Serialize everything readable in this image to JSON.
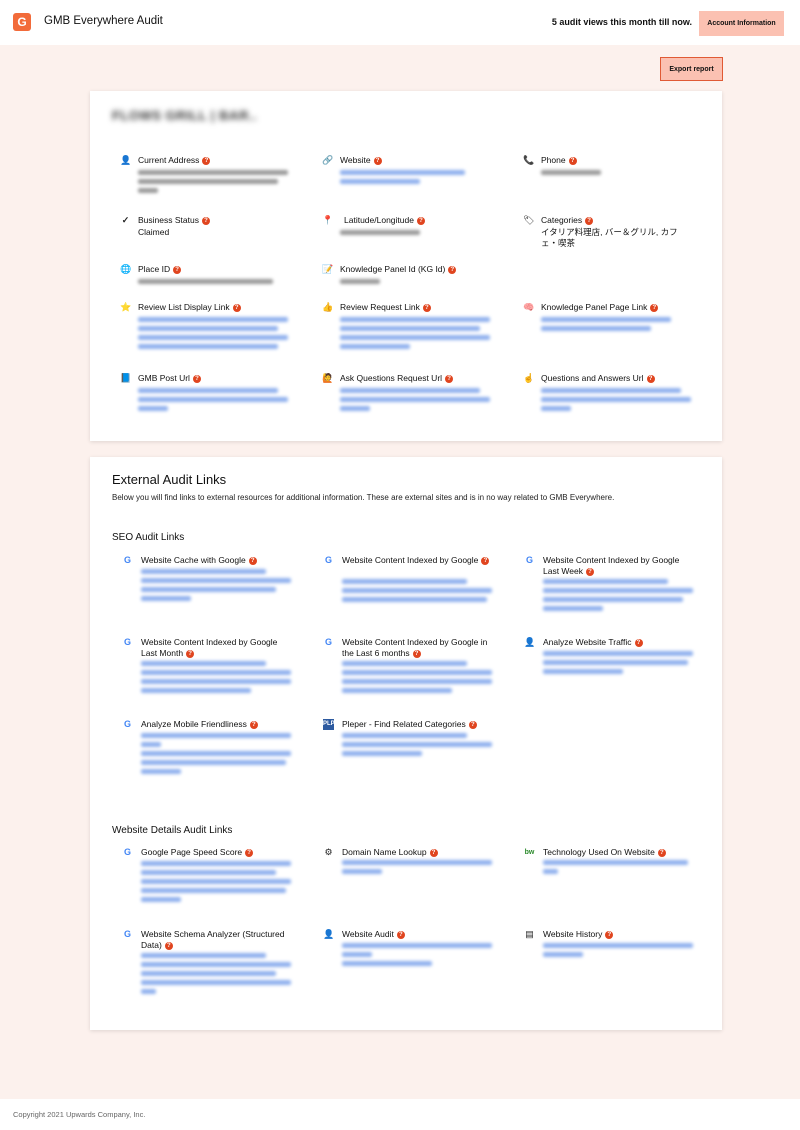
{
  "header": {
    "logo_letter": "G",
    "title": "GMB Everywhere Audit",
    "views_text": "5 audit views this month till now.",
    "account_label": "Account Information"
  },
  "export_label": "Export report",
  "business": {
    "name": "FLOWS GRILL | BAR..",
    "fields": [
      {
        "label": "Current Address",
        "icon": "person-icon",
        "value": ""
      },
      {
        "label": "Website",
        "icon": "link-icon",
        "value": ""
      },
      {
        "label": "Phone",
        "icon": "phone-icon",
        "value": ""
      },
      {
        "label": "Business Status",
        "icon": "check-icon",
        "value": "Claimed"
      },
      {
        "label": "Latitude/Longitude",
        "icon": "pin-icon",
        "value": ""
      },
      {
        "label": "Categories",
        "icon": "tag-icon",
        "value": "イタリア料理店, バー＆グリル, カフェ・喫茶"
      },
      {
        "label": "Place ID",
        "icon": "globe-icon",
        "value": ""
      },
      {
        "label": "Knowledge Panel Id (KG Id)",
        "icon": "note-icon",
        "value": ""
      },
      {
        "label": "Review List Display Link",
        "icon": "star-icon",
        "value": ""
      },
      {
        "label": "Review Request Link",
        "icon": "thumbs-up-icon",
        "value": ""
      },
      {
        "label": "Knowledge Panel Page Link",
        "icon": "brain-icon",
        "value": ""
      },
      {
        "label": "GMB Post Url",
        "icon": "book-icon",
        "value": ""
      },
      {
        "label": "Ask Questions Request Url",
        "icon": "question-person-icon",
        "value": ""
      },
      {
        "label": "Questions and Answers Url",
        "icon": "pointing-hand-icon",
        "value": ""
      }
    ]
  },
  "external": {
    "title": "External Audit Links",
    "description": "Below you will find links to external resources for additional information. These are external sites and is in no way related to GMB Everywhere.",
    "seo_title": "SEO Audit Links",
    "seo_links": [
      {
        "label": "Website Cache with Google",
        "icon": "google-icon"
      },
      {
        "label": "Website Content Indexed by Google",
        "icon": "google-icon"
      },
      {
        "label": "Website Content Indexed by Google Last Week",
        "icon": "google-icon"
      },
      {
        "label": "Website Content Indexed by Google Last Month",
        "icon": "google-icon"
      },
      {
        "label": "Website Content Indexed by Google in the Last 6 months",
        "icon": "google-icon"
      },
      {
        "label": "Analyze Website Traffic",
        "icon": "person-icon"
      },
      {
        "label": "Analyze Mobile Friendliness",
        "icon": "google-icon"
      },
      {
        "label": "Pleper - Find Related Categories",
        "icon": "pleper-icon"
      }
    ],
    "details_title": "Website Details Audit Links",
    "details_links": [
      {
        "label": "Google Page Speed Score",
        "icon": "google-icon"
      },
      {
        "label": "Domain Name Lookup",
        "icon": "gear-icon"
      },
      {
        "label": "Technology Used On Website",
        "icon": "builtwith-icon"
      },
      {
        "label": "Website Schema Analyzer (Structured Data)",
        "icon": "google-icon"
      },
      {
        "label": "Website Audit",
        "icon": "person-icon"
      },
      {
        "label": "Website History",
        "icon": "archive-icon"
      }
    ]
  },
  "footer": "Copyright 2021 Upwards Company, Inc."
}
